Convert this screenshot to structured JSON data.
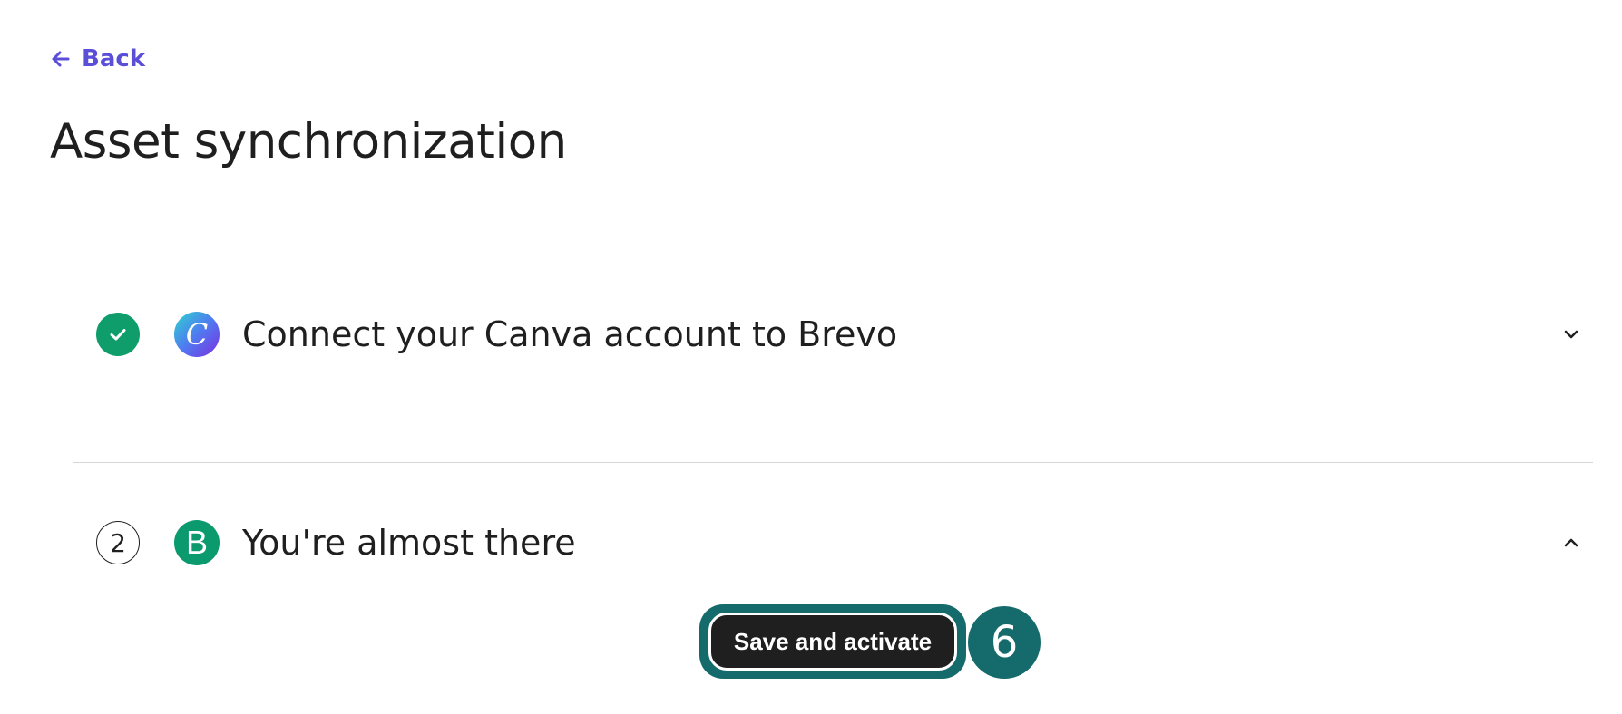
{
  "header": {
    "back_label": "Back",
    "title": "Asset synchronization"
  },
  "steps": [
    {
      "status": "completed",
      "status_icon": "check-icon",
      "app_logo": "canva-logo",
      "logo_letter": "C",
      "title": "Connect your Canva account to Brevo",
      "expand_icon": "chevron-down-icon"
    },
    {
      "status": "current",
      "number": "2",
      "app_logo": "brevo-logo",
      "logo_letter": "B",
      "title": "You're almost there",
      "expand_icon": "chevron-up-icon"
    }
  ],
  "actions": {
    "save_label": "Save and activate",
    "step_marker": "6"
  },
  "colors": {
    "accent": "#5b4fd8",
    "success": "#0f9d6c",
    "highlight": "#156b6c",
    "button_bg": "#1f1f1f"
  }
}
